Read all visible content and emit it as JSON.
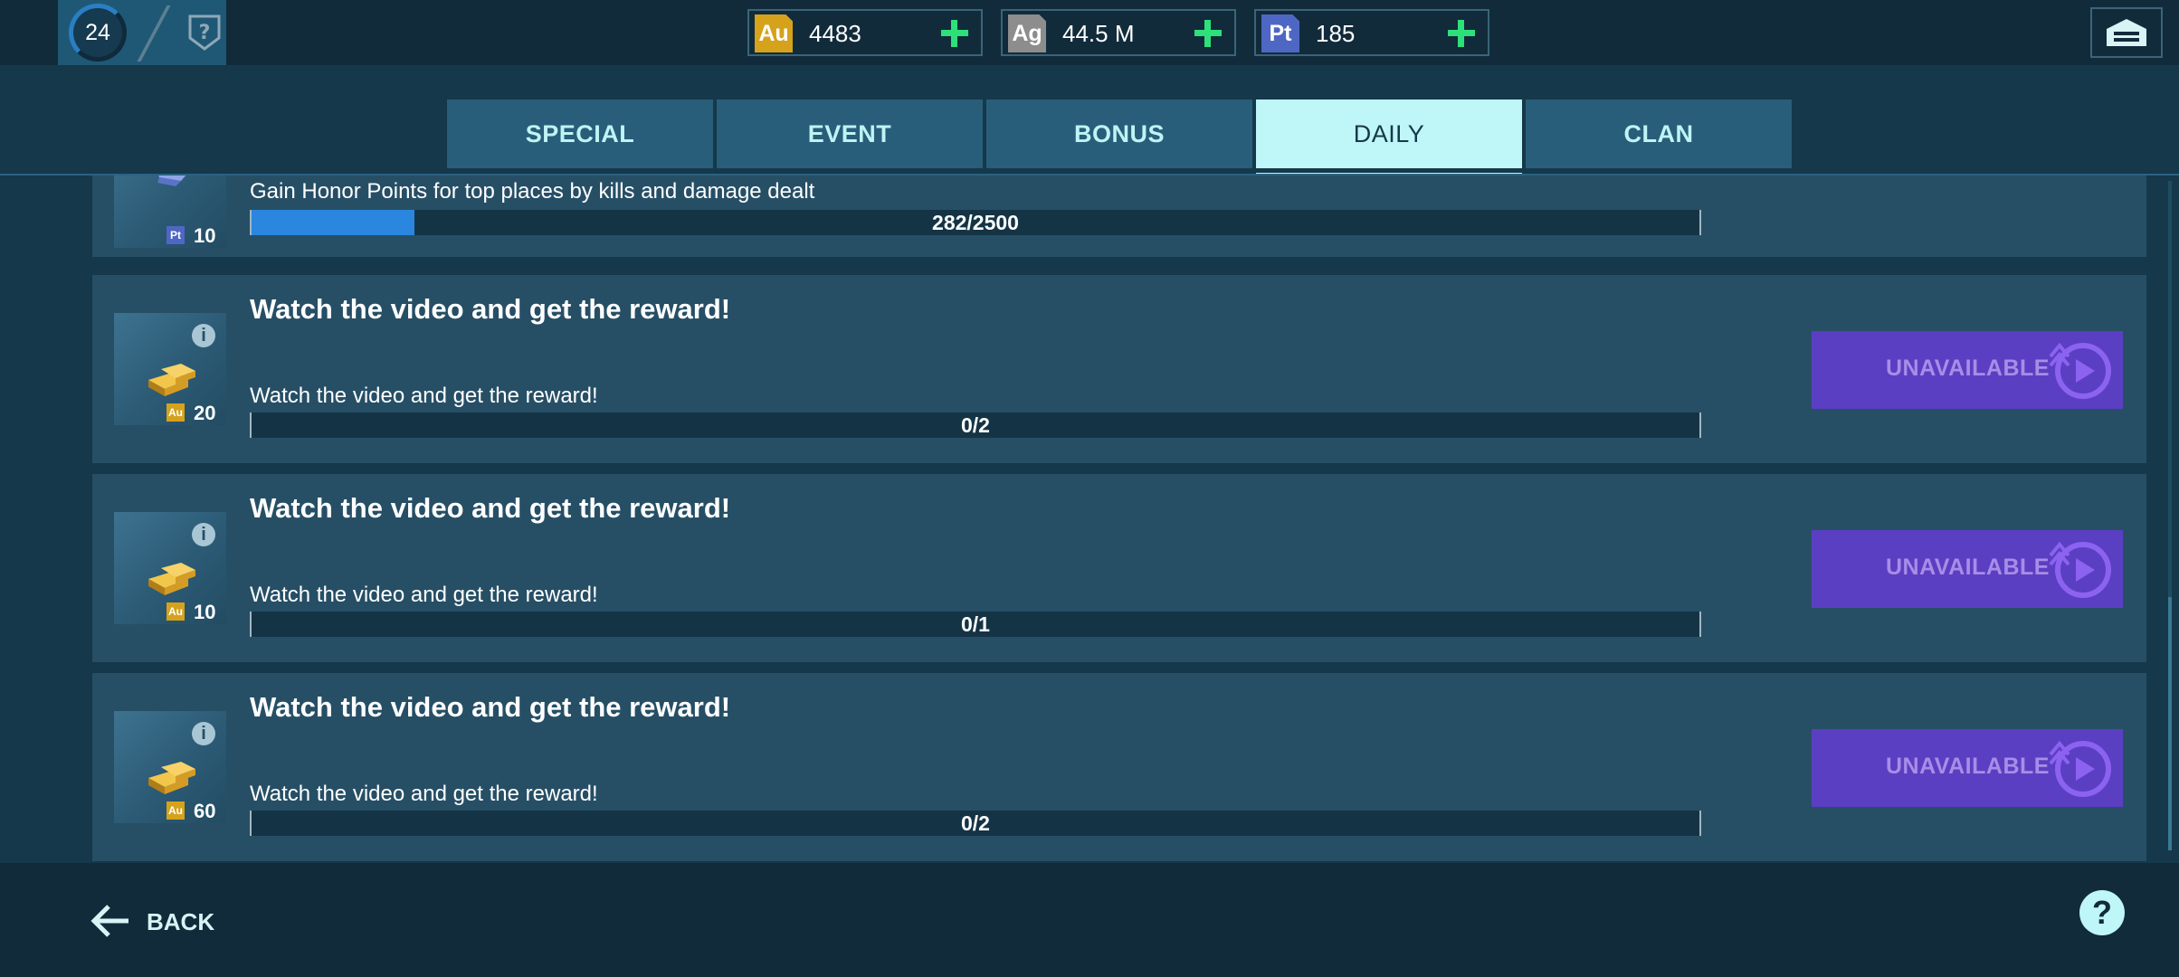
{
  "header": {
    "level": "24",
    "currencies": [
      {
        "symbol": "Au",
        "value": "4483",
        "color": "#d6a21c"
      },
      {
        "symbol": "Ag",
        "value": "44.5 M",
        "color": "#8d8d8d"
      },
      {
        "symbol": "Pt",
        "value": "185",
        "color": "#4f67c4"
      }
    ]
  },
  "tabs": [
    {
      "label": "SPECIAL",
      "active": false
    },
    {
      "label": "EVENT",
      "active": false
    },
    {
      "label": "BONUS",
      "active": false
    },
    {
      "label": "DAILY",
      "active": true
    },
    {
      "label": "CLAN",
      "active": false
    }
  ],
  "tasks": [
    {
      "title": "",
      "description": "Gain Honor Points for top places by kills and damage dealt",
      "progress_text": "282/2500",
      "progress": 0.1128,
      "reward_currency": "Pt",
      "reward_amount": "10",
      "button": ""
    },
    {
      "title": "Watch the video and get the reward!",
      "description": "Watch the video and get the reward!",
      "progress_text": "0/2",
      "progress": 0,
      "reward_currency": "Au",
      "reward_amount": "20",
      "button": "UNAVAILABLE"
    },
    {
      "title": "Watch the video and get the reward!",
      "description": "Watch the video and get the reward!",
      "progress_text": "0/1",
      "progress": 0,
      "reward_currency": "Au",
      "reward_amount": "10",
      "button": "UNAVAILABLE"
    },
    {
      "title": "Watch the video and get the reward!",
      "description": "Watch the video and get the reward!",
      "progress_text": "0/2",
      "progress": 0,
      "reward_currency": "Au",
      "reward_amount": "60",
      "button": "UNAVAILABLE"
    }
  ],
  "footer": {
    "back_label": "BACK",
    "help_label": "?"
  },
  "icons": {
    "garage": "garage-icon",
    "back": "arrow-left-icon",
    "help": "question-icon",
    "play": "play-icon",
    "info": "info-icon"
  },
  "colors": {
    "accent": "#bff6f7",
    "plus": "#2ee07a",
    "button_unavailable": "#5b3fc2",
    "progress_fill": "#2a86df"
  }
}
